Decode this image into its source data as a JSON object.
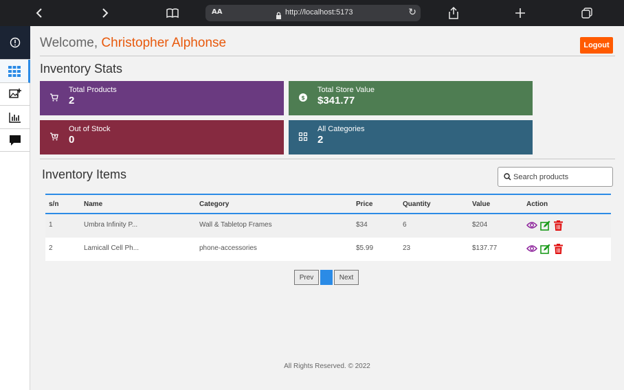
{
  "browser": {
    "url_prefix": "AA",
    "url": "http://localhost:5173"
  },
  "header": {
    "welcome": "Welcome,",
    "user_name": "Christopher Alphonse",
    "logout_label": "Logout"
  },
  "stats": {
    "title": "Inventory Stats",
    "cards": [
      {
        "label": "Total Products",
        "value": "2",
        "color": "#6a3a80",
        "icon": "cart-icon"
      },
      {
        "label": "Total Store Value",
        "value": "$341.77",
        "color": "#4e7d52",
        "icon": "dollar-icon"
      },
      {
        "label": "Out of Stock",
        "value": "0",
        "color": "#862a40",
        "icon": "cart-x-icon"
      },
      {
        "label": "All Categories",
        "value": "2",
        "color": "#31637e",
        "icon": "categories-icon"
      }
    ]
  },
  "inventory": {
    "title": "Inventory Items",
    "search_placeholder": "Search products",
    "columns": [
      "s/n",
      "Name",
      "Category",
      "Price",
      "Quantity",
      "Value",
      "Action"
    ],
    "rows": [
      [
        "1",
        "Umbra Infinity P...",
        "Wall & Tabletop Frames",
        "$34",
        "6",
        "$204"
      ],
      [
        "2",
        "Lamicall Cell Ph...",
        "phone-accessories",
        "$5.99",
        "23",
        "$137.77"
      ]
    ]
  },
  "pagination": {
    "prev": "Prev",
    "current": "1",
    "next": "Next"
  },
  "footer": {
    "text": "All Rights Reserved. © 2022"
  },
  "colors": {
    "accent": "#2b8be6",
    "logout": "#ff5a00",
    "username": "#e8590c",
    "view": "#8b1f9a",
    "edit": "#1a9a1a",
    "delete": "#e01010"
  }
}
